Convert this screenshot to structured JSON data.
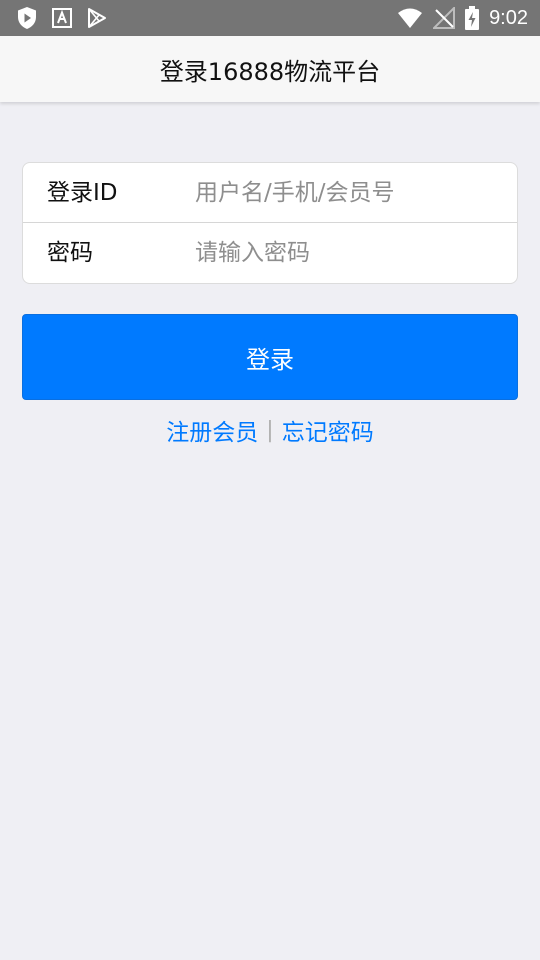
{
  "status_bar": {
    "time": "9:02",
    "left_icons": [
      "shield-play-icon",
      "text-a-icon",
      "play-store-icon"
    ],
    "right_icons": [
      "wifi-icon",
      "no-signal-icon",
      "battery-charging-icon"
    ]
  },
  "header": {
    "title": "登录16888物流平台"
  },
  "form": {
    "login_id": {
      "label": "登录ID",
      "placeholder": "用户名/手机/会员号",
      "value": ""
    },
    "password": {
      "label": "密码",
      "placeholder": "请输入密码",
      "value": ""
    }
  },
  "actions": {
    "login_label": "登录",
    "register_label": "注册会员",
    "separator": "|",
    "forgot_label": "忘记密码"
  },
  "colors": {
    "accent": "#007aff",
    "background": "#efeff4",
    "status_bar": "#757575"
  }
}
